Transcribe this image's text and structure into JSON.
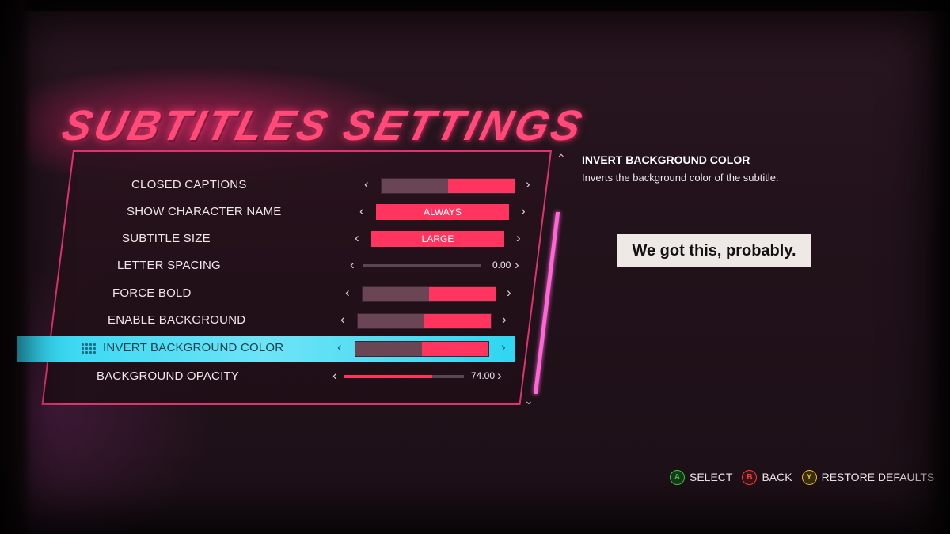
{
  "page_title": "SUBTITLES SETTINGS",
  "settings": [
    {
      "label": "CLOSED CAPTIONS",
      "control": "toggle"
    },
    {
      "label": "SHOW CHARACTER NAME",
      "control": "select",
      "value": "ALWAYS"
    },
    {
      "label": "SUBTITLE SIZE",
      "control": "select",
      "value": "LARGE"
    },
    {
      "label": "LETTER SPACING",
      "control": "slider",
      "value": "0.00",
      "fraction": 0.0
    },
    {
      "label": "FORCE BOLD",
      "control": "toggle"
    },
    {
      "label": "ENABLE BACKGROUND",
      "control": "toggle"
    },
    {
      "label": "INVERT BACKGROUND COLOR",
      "control": "toggle",
      "selected": true
    },
    {
      "label": "BACKGROUND OPACITY",
      "control": "slider",
      "value": "74.00",
      "fraction": 0.74
    }
  ],
  "arrows": {
    "left": "‹",
    "right": "›",
    "up": "⌃",
    "down": "⌄"
  },
  "info": {
    "title": "INVERT BACKGROUND COLOR",
    "description": "Inverts the background color of the subtitle."
  },
  "preview_text": "We got this, probably.",
  "footer": {
    "select": {
      "key": "A",
      "label": "SELECT"
    },
    "back": {
      "key": "B",
      "label": "BACK"
    },
    "restore": {
      "key": "Y",
      "label": "RESTORE DEFAULTS"
    }
  },
  "colors": {
    "accent": "#ff3560",
    "highlight": "#2fd6f2",
    "scrollbar": "#ff66d6"
  }
}
